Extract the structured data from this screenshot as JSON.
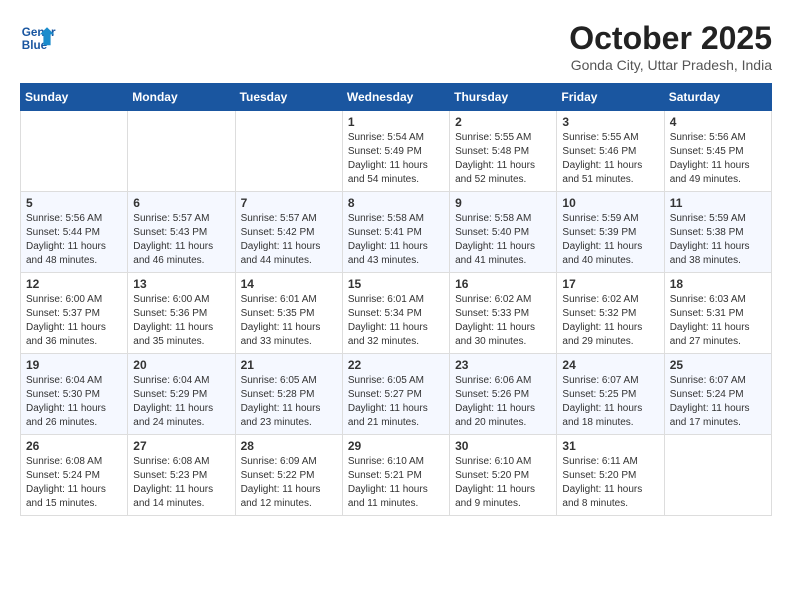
{
  "logo": {
    "line1": "General",
    "line2": "Blue"
  },
  "title": "October 2025",
  "subtitle": "Gonda City, Uttar Pradesh, India",
  "weekdays": [
    "Sunday",
    "Monday",
    "Tuesday",
    "Wednesday",
    "Thursday",
    "Friday",
    "Saturday"
  ],
  "weeks": [
    [
      null,
      null,
      null,
      {
        "day": 1,
        "sunrise": "5:54 AM",
        "sunset": "5:49 PM",
        "daylight": "11 hours and 54 minutes."
      },
      {
        "day": 2,
        "sunrise": "5:55 AM",
        "sunset": "5:48 PM",
        "daylight": "11 hours and 52 minutes."
      },
      {
        "day": 3,
        "sunrise": "5:55 AM",
        "sunset": "5:46 PM",
        "daylight": "11 hours and 51 minutes."
      },
      {
        "day": 4,
        "sunrise": "5:56 AM",
        "sunset": "5:45 PM",
        "daylight": "11 hours and 49 minutes."
      }
    ],
    [
      {
        "day": 5,
        "sunrise": "5:56 AM",
        "sunset": "5:44 PM",
        "daylight": "11 hours and 48 minutes."
      },
      {
        "day": 6,
        "sunrise": "5:57 AM",
        "sunset": "5:43 PM",
        "daylight": "11 hours and 46 minutes."
      },
      {
        "day": 7,
        "sunrise": "5:57 AM",
        "sunset": "5:42 PM",
        "daylight": "11 hours and 44 minutes."
      },
      {
        "day": 8,
        "sunrise": "5:58 AM",
        "sunset": "5:41 PM",
        "daylight": "11 hours and 43 minutes."
      },
      {
        "day": 9,
        "sunrise": "5:58 AM",
        "sunset": "5:40 PM",
        "daylight": "11 hours and 41 minutes."
      },
      {
        "day": 10,
        "sunrise": "5:59 AM",
        "sunset": "5:39 PM",
        "daylight": "11 hours and 40 minutes."
      },
      {
        "day": 11,
        "sunrise": "5:59 AM",
        "sunset": "5:38 PM",
        "daylight": "11 hours and 38 minutes."
      }
    ],
    [
      {
        "day": 12,
        "sunrise": "6:00 AM",
        "sunset": "5:37 PM",
        "daylight": "11 hours and 36 minutes."
      },
      {
        "day": 13,
        "sunrise": "6:00 AM",
        "sunset": "5:36 PM",
        "daylight": "11 hours and 35 minutes."
      },
      {
        "day": 14,
        "sunrise": "6:01 AM",
        "sunset": "5:35 PM",
        "daylight": "11 hours and 33 minutes."
      },
      {
        "day": 15,
        "sunrise": "6:01 AM",
        "sunset": "5:34 PM",
        "daylight": "11 hours and 32 minutes."
      },
      {
        "day": 16,
        "sunrise": "6:02 AM",
        "sunset": "5:33 PM",
        "daylight": "11 hours and 30 minutes."
      },
      {
        "day": 17,
        "sunrise": "6:02 AM",
        "sunset": "5:32 PM",
        "daylight": "11 hours and 29 minutes."
      },
      {
        "day": 18,
        "sunrise": "6:03 AM",
        "sunset": "5:31 PM",
        "daylight": "11 hours and 27 minutes."
      }
    ],
    [
      {
        "day": 19,
        "sunrise": "6:04 AM",
        "sunset": "5:30 PM",
        "daylight": "11 hours and 26 minutes."
      },
      {
        "day": 20,
        "sunrise": "6:04 AM",
        "sunset": "5:29 PM",
        "daylight": "11 hours and 24 minutes."
      },
      {
        "day": 21,
        "sunrise": "6:05 AM",
        "sunset": "5:28 PM",
        "daylight": "11 hours and 23 minutes."
      },
      {
        "day": 22,
        "sunrise": "6:05 AM",
        "sunset": "5:27 PM",
        "daylight": "11 hours and 21 minutes."
      },
      {
        "day": 23,
        "sunrise": "6:06 AM",
        "sunset": "5:26 PM",
        "daylight": "11 hours and 20 minutes."
      },
      {
        "day": 24,
        "sunrise": "6:07 AM",
        "sunset": "5:25 PM",
        "daylight": "11 hours and 18 minutes."
      },
      {
        "day": 25,
        "sunrise": "6:07 AM",
        "sunset": "5:24 PM",
        "daylight": "11 hours and 17 minutes."
      }
    ],
    [
      {
        "day": 26,
        "sunrise": "6:08 AM",
        "sunset": "5:24 PM",
        "daylight": "11 hours and 15 minutes."
      },
      {
        "day": 27,
        "sunrise": "6:08 AM",
        "sunset": "5:23 PM",
        "daylight": "11 hours and 14 minutes."
      },
      {
        "day": 28,
        "sunrise": "6:09 AM",
        "sunset": "5:22 PM",
        "daylight": "11 hours and 12 minutes."
      },
      {
        "day": 29,
        "sunrise": "6:10 AM",
        "sunset": "5:21 PM",
        "daylight": "11 hours and 11 minutes."
      },
      {
        "day": 30,
        "sunrise": "6:10 AM",
        "sunset": "5:20 PM",
        "daylight": "11 hours and 9 minutes."
      },
      {
        "day": 31,
        "sunrise": "6:11 AM",
        "sunset": "5:20 PM",
        "daylight": "11 hours and 8 minutes."
      },
      null
    ]
  ]
}
